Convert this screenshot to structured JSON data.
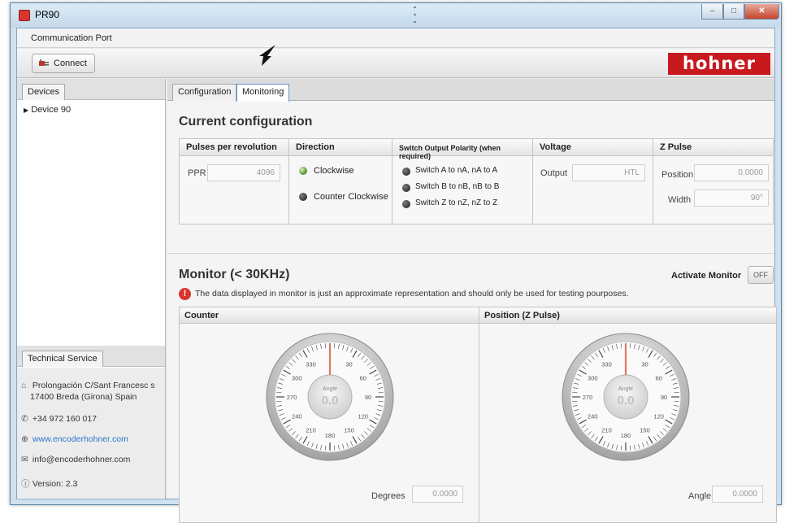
{
  "window": {
    "title": "PR90"
  },
  "menu": {
    "items": [
      "Communication Port"
    ]
  },
  "toolbar": {
    "connect_label": "Connect",
    "logo_text": "hohner"
  },
  "left_panel": {
    "devices_tab": "Devices",
    "tree_item": "Device 90",
    "tech_tab": "Technical Service",
    "address_line1": "Prolongación C/Sant Francesc s",
    "address_line2": "17400 Breda (Girona) Spain",
    "phone": "+34 972 160 017",
    "website": "www.encoderhohner.com",
    "email": "info@encoderhohner.com",
    "version": "Version: 2.3"
  },
  "tabs": [
    {
      "label": "Configuration",
      "active": false
    },
    {
      "label": "Monitoring",
      "active": true
    }
  ],
  "config": {
    "title": "Current configuration",
    "pulses": {
      "header": "Pulses per revolution",
      "label": "PPR",
      "value": "4096"
    },
    "direction": {
      "header": "Direction",
      "options": [
        {
          "label": "Clockwise",
          "state": "on"
        },
        {
          "label": "Counter Clockwise",
          "state": "off"
        }
      ]
    },
    "switch": {
      "header": "Switch Output Polarity (when required)",
      "options": [
        "Switch A to nA, nA to A",
        "Switch B to nB, nB to B",
        "Switch Z to nZ, nZ to Z"
      ]
    },
    "voltage": {
      "header": "Voltage",
      "label": "Output",
      "value": "HTL"
    },
    "zpulse": {
      "header": "Z Pulse",
      "position_label": "Position",
      "position_value": "0.0000",
      "width_label": "Width",
      "width_value": "90°"
    }
  },
  "monitor": {
    "title": "Monitor (< 30KHz)",
    "activate_label": "Activate Monitor",
    "toggle_label": "OFF",
    "warning": "The data displayed in monitor is just an approximate representation and should only be used for testing pourposes.",
    "counter": {
      "header": "Counter",
      "gauge_label": "Angle",
      "gauge_value": "0.0",
      "field_label": "Degrees",
      "field_value": "0.0000"
    },
    "position": {
      "header": "Position (Z Pulse)",
      "gauge_label": "Angle",
      "gauge_value": "0.0",
      "field_label": "Angle",
      "field_value": "0.0000"
    },
    "dial_labels": [
      "330",
      "30",
      "300",
      "60",
      "270",
      "90",
      "240",
      "120",
      "210",
      "150",
      "180"
    ]
  },
  "colors": {
    "brand": "#c8191f",
    "led_on": "#5e9b3e",
    "needle": "#e07866",
    "link": "#2f74c9"
  }
}
